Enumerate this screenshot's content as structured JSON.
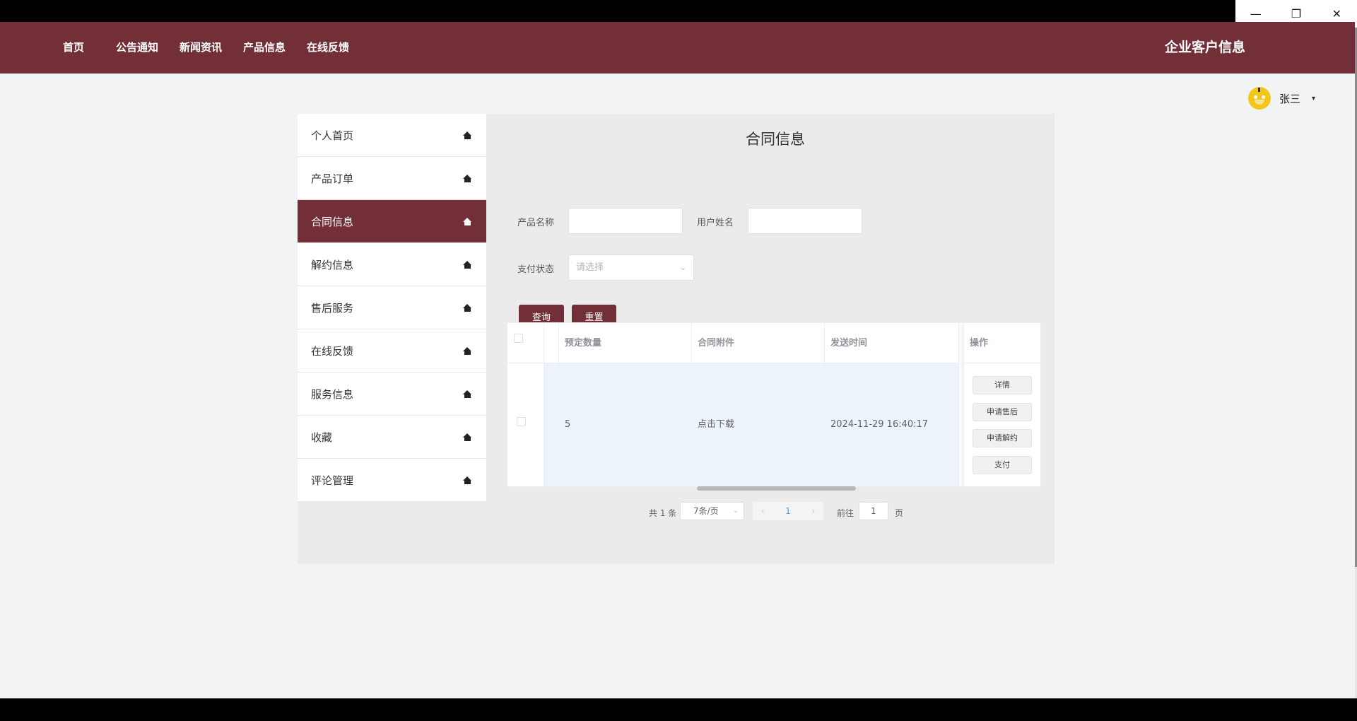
{
  "window": {
    "minimize_icon": "minimize-icon",
    "restore_icon": "restore-icon",
    "close_icon": "close-icon"
  },
  "topnav": {
    "items": [
      "首页",
      "公告通知",
      "新闻资讯",
      "产品信息",
      "在线反馈"
    ],
    "brand": "企业客户信息"
  },
  "user": {
    "name": "张三",
    "caret": "▾"
  },
  "sidemenu": {
    "items": [
      {
        "label": "个人首页",
        "active": false
      },
      {
        "label": "产品订单",
        "active": false
      },
      {
        "label": "合同信息",
        "active": true
      },
      {
        "label": "解约信息",
        "active": false
      },
      {
        "label": "售后服务",
        "active": false
      },
      {
        "label": "在线反馈",
        "active": false
      },
      {
        "label": "服务信息",
        "active": false
      },
      {
        "label": "收藏",
        "active": false
      },
      {
        "label": "评论管理",
        "active": false
      }
    ],
    "icon": "home-icon"
  },
  "content": {
    "title": "合同信息",
    "search": {
      "product_name_label": "产品名称",
      "product_name_value": "",
      "user_name_label": "用户姓名",
      "user_name_value": "",
      "pay_status_label": "支付状态",
      "pay_status_placeholder": "请选择",
      "query_button": "查询",
      "reset_button": "重置"
    },
    "table": {
      "columns": [
        "预定数量",
        "合同附件",
        "发送时间",
        "操作"
      ],
      "rows": [
        {
          "quantity": "5",
          "attachment": "点击下载",
          "send_time": "2024-11-29 16:40:17",
          "actions": [
            "详情",
            "申请售后",
            "申请解约",
            "支付"
          ]
        }
      ]
    },
    "pagination": {
      "total_text": "共 1 条",
      "page_size": "7条/页",
      "current_page": "1",
      "prev": "‹",
      "next": "›",
      "goto_label": "前往",
      "goto_value": "1",
      "page_suffix": "页"
    }
  }
}
